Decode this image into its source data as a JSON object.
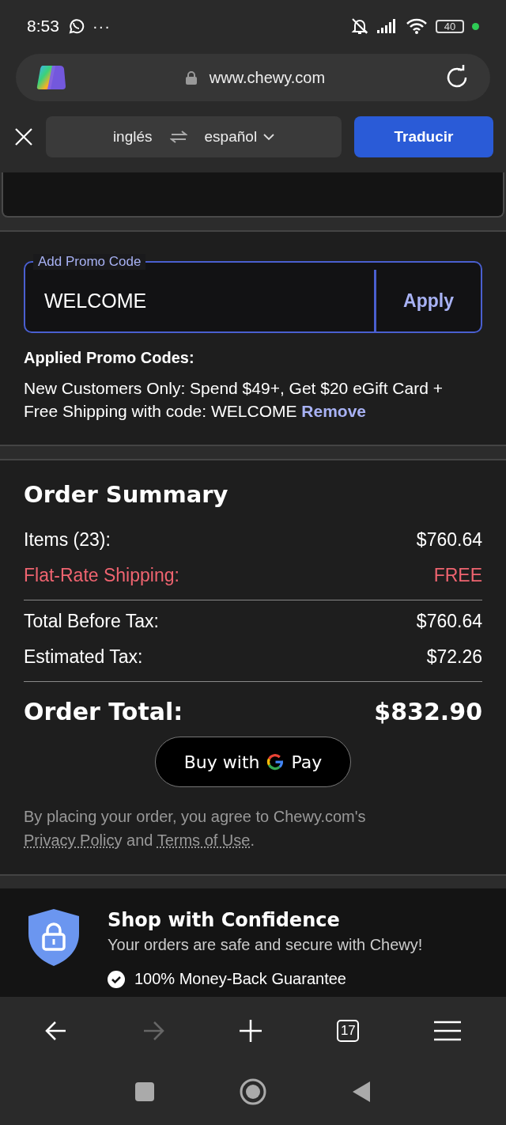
{
  "status_bar": {
    "time": "8:53",
    "more": "···",
    "battery": "40"
  },
  "browser": {
    "url": "www.chewy.com"
  },
  "translate_bar": {
    "source_language": "inglés",
    "target_language": "español",
    "button": "Traducir"
  },
  "promo": {
    "label": "Add Promo Code",
    "value": "WELCOME",
    "button": "Apply",
    "applied_title": "Applied Promo Codes:",
    "applied_text": "New Customers Only: Spend $49+, Get $20 eGift Card + Free Shipping with code: WELCOME",
    "remove_link": "Remove"
  },
  "order_summary": {
    "title": "Order Summary",
    "groups": [
      [
        {
          "label": "Items (23):",
          "value": "$760.64",
          "kind": "plain"
        },
        {
          "label": "Flat-Rate Shipping:",
          "value": "FREE",
          "kind": "promo"
        }
      ],
      [
        {
          "label": "Total Before Tax:",
          "value": "$760.64",
          "kind": "plain"
        },
        {
          "label": "Estimated Tax:",
          "value": "$72.26",
          "kind": "plain"
        }
      ]
    ],
    "total_label": "Order Total:",
    "total_value": "$832.90",
    "gpay_button": {
      "before": "Buy with",
      "after": "Pay"
    },
    "legal": {
      "text": "By placing your order, you agree to Chewy.com's",
      "privacy_link": "Privacy Policy",
      "joiner": "and",
      "terms_link": "Terms of Use",
      "end": "."
    }
  },
  "confidence": {
    "title": "Shop with Confidence",
    "subtitle": "Your orders are safe and secure with Chewy!",
    "items": [
      "100% Money-Back Guarantee"
    ]
  },
  "bottom_nav": [
    {
      "kind": "back",
      "disabled": false
    },
    {
      "kind": "forward",
      "disabled": true
    },
    {
      "kind": "new-tab",
      "disabled": false
    },
    {
      "kind": "tabs",
      "label": "17",
      "disabled": false
    },
    {
      "kind": "menu",
      "disabled": false
    }
  ]
}
